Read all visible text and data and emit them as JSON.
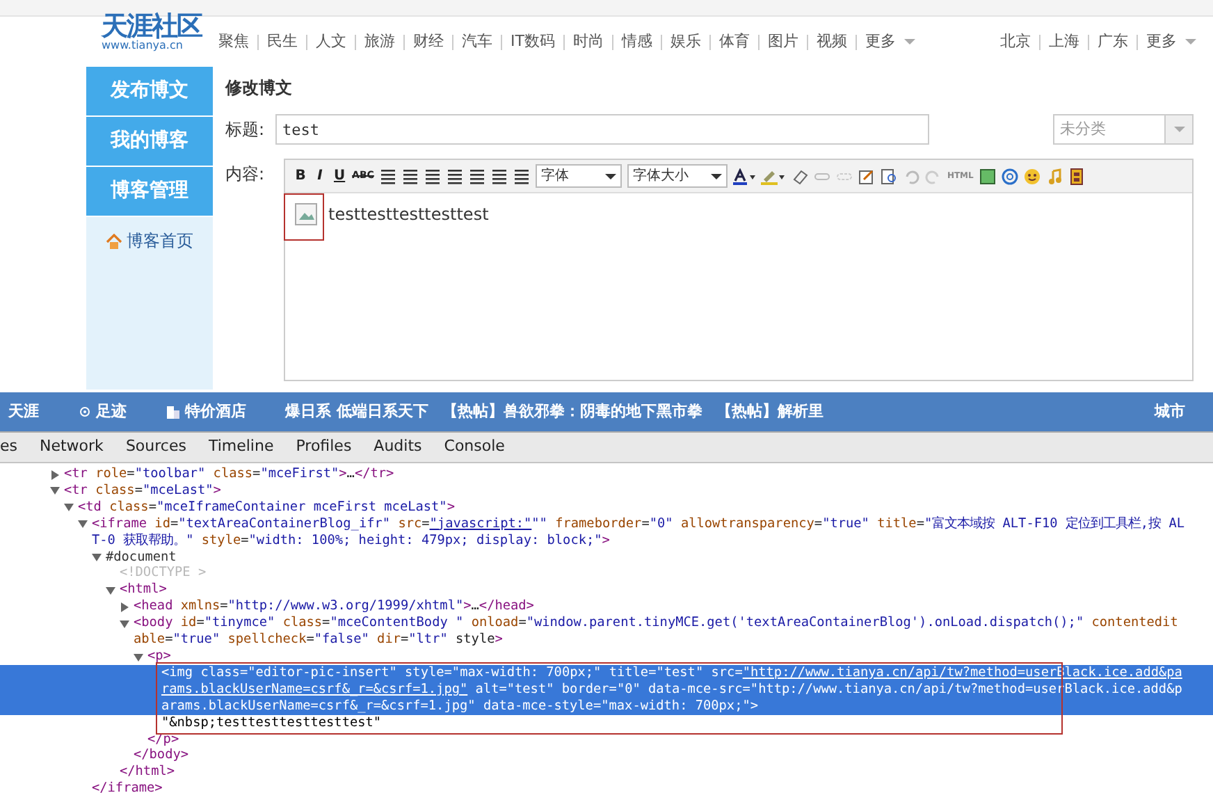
{
  "header": {
    "logo": "天涯社区",
    "logo_url": "www.tianya.cn",
    "nav": [
      "聚焦",
      "民生",
      "人文",
      "旅游",
      "财经",
      "汽车",
      "IT数码",
      "时尚",
      "情感",
      "娱乐",
      "体育",
      "图片",
      "视频",
      "更多"
    ],
    "cities": [
      "北京",
      "上海",
      "广东",
      "更多"
    ]
  },
  "sidebar": {
    "items": [
      {
        "label": "发布博文",
        "kind": "button"
      },
      {
        "label": "我的博客",
        "kind": "button"
      },
      {
        "label": "博客管理",
        "kind": "button"
      },
      {
        "label": "博客首页",
        "kind": "link"
      }
    ]
  },
  "editor": {
    "heading": "修改博文",
    "title_label": "标题:",
    "title_value": "test",
    "category": "未分类",
    "content_label": "内容:",
    "format_buttons": [
      "B",
      "I",
      "U",
      "ABC"
    ],
    "font": "字体",
    "font_size": "字体大小",
    "html_button": "HTML",
    "content_text": "testtesttesttesttest",
    "image_alt_broken": true
  },
  "banner": {
    "items": [
      "天涯",
      "足迹",
      "特价酒店",
      "爆日系  低端日系天下",
      "【热帖】兽欲邪拳：阴毒的地下黑市拳",
      "【热帖】解析里"
    ],
    "right": "城市"
  },
  "devtools": {
    "tabs": [
      {
        "label": "es",
        "selected": false
      },
      {
        "label": "Network",
        "selected": false
      },
      {
        "label": "Sources",
        "selected": false
      },
      {
        "label": "Timeline",
        "selected": false
      },
      {
        "label": "Profiles",
        "selected": false
      },
      {
        "label": "Audits",
        "selected": false
      },
      {
        "label": "Console",
        "selected": false
      }
    ],
    "tree": [
      {
        "kind": "element",
        "open": "<tr role=\"toolbar\" class=\"mceFirst\">…</tr>",
        "expanded": false,
        "selected": false
      },
      {
        "kind": "element",
        "open": "<tr class=\"mceLast\">",
        "expanded": true,
        "selected": false,
        "children": [
          {
            "kind": "element",
            "open": "<td class=\"mceIframeContainer mceFirst mceLast\">",
            "expanded": true,
            "selected": false,
            "children": [
              {
                "kind": "element",
                "open": "<iframe id=\"textAreaContainerBlog_ifr\" src=\"javascript:\"\"\" frameborder=\"0\" allowtransparency=\"true\" title=\"富文本域按 ALT-F10 定位到工具栏,按 ALT-0 获取帮助。\" style=\"width: 100%; height: 479px; display: block;\">",
                "expanded": true,
                "selected": false,
                "close": "</iframe>",
                "children": [
                  {
                    "kind": "document",
                    "open": "#document",
                    "expanded": true,
                    "selected": false,
                    "children": [
                      {
                        "kind": "doctype",
                        "open": "<!DOCTYPE >",
                        "selected": false
                      },
                      {
                        "kind": "element",
                        "open": "<html>",
                        "expanded": true,
                        "selected": false,
                        "close": "</html>",
                        "children": [
                          {
                            "kind": "element",
                            "open": "<head xmlns=\"http://www.w3.org/1999/xhtml\">…</head>",
                            "expanded": false,
                            "selected": false
                          },
                          {
                            "kind": "element",
                            "open": "<body id=\"tinymce\" class=\"mceContentBody \" onload=\"window.parent.tinyMCE.get('textAreaContainerBlog').onLoad.dispatch();\" contenteditable=\"true\" spellcheck=\"false\" dir=\"ltr\" style>",
                            "expanded": true,
                            "selected": false,
                            "close": "</body>",
                            "children": [
                              {
                                "kind": "element",
                                "open": "<p>",
                                "expanded": true,
                                "selected": false,
                                "close": "</p>",
                                "children": [
                                  {
                                    "kind": "element",
                                    "open": "<img class=\"editor-pic-insert\" style=\"max-width: 700px;\" title=\"test\" src=\"http://www.tianya.cn/api/tw?method=userBlack.ice.add&params.blackUserName=csrf&_r=&csrf=1.jpg\" alt=\"test\" border=\"0\" data-mce-src=\"http://www.tianya.cn/api/tw?method=userBlack.ice.add&params.blackUserName=csrf&_r=&csrf=1.jpg\" data-mce-style=\"max-width: 700px;\">",
                                    "selected": true
                                  },
                                  {
                                    "kind": "text",
                                    "open": "\"&nbsp;testtesttesttesttest\"",
                                    "selected": false
                                  }
                                ]
                              }
                            ]
                          }
                        ]
                      }
                    ]
                  }
                ]
              }
            ]
          }
        ]
      }
    ]
  }
}
